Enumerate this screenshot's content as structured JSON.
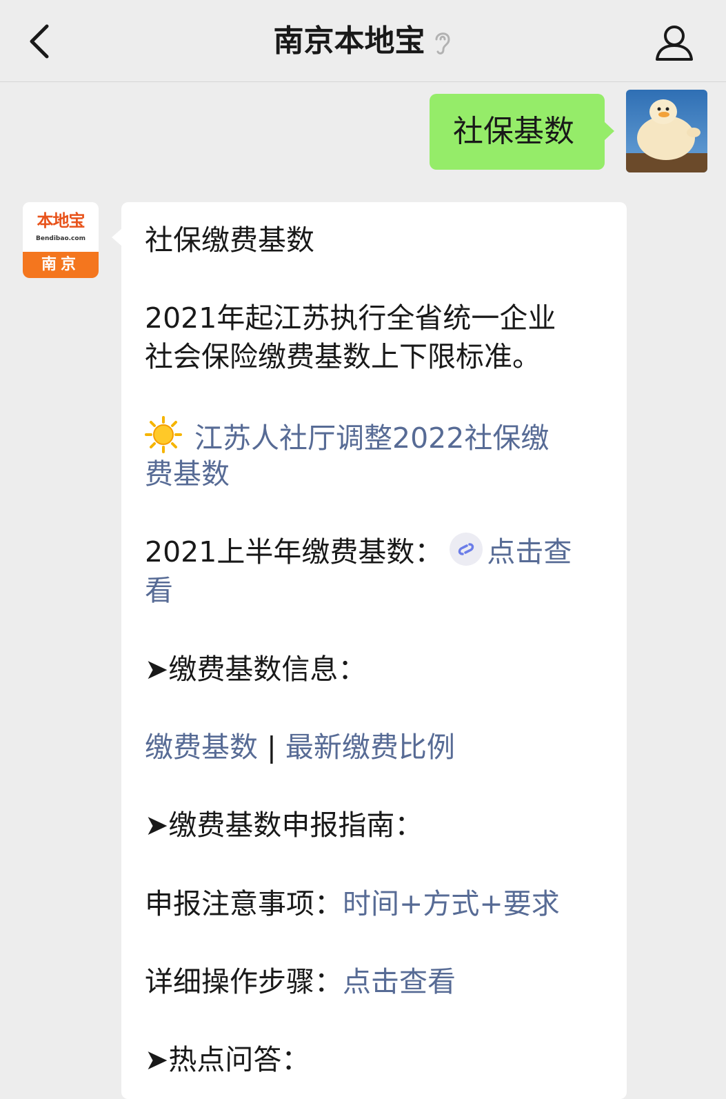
{
  "nav": {
    "title": "南京本地宝"
  },
  "user_message": {
    "text": "社保基数"
  },
  "bot": {
    "logo": {
      "name": "本地宝",
      "url": "Bendibao.com",
      "city": "南京"
    },
    "lines": {
      "title": "社保缴费基数",
      "intro_1": "2021年起江苏执行全省统一企业",
      "intro_2": "社会保险缴费基数上下限标准。",
      "adjust_link_1": "江苏人社厅调整2022社保缴",
      "adjust_link_2": "费基数",
      "h1_label": "2021上半年缴费基数：",
      "h1_link_1": "点击查",
      "h1_link_2": "看",
      "section_info": "➤缴费基数信息：",
      "info_link_a": "缴费基数",
      "info_sep": " | ",
      "info_link_b": "最新缴费比例",
      "section_guide": "➤缴费基数申报指南：",
      "notes_label": "申报注意事项：",
      "notes_link": "时间+方式+要求",
      "steps_label": "详细操作步骤：",
      "steps_link": "点击查看",
      "section_hot": "➤热点问答："
    }
  },
  "colors": {
    "background": "#ededed",
    "user_bubble": "#95ec69",
    "bot_bubble": "#ffffff",
    "link": "#576b95",
    "logo_orange": "#f4761e"
  },
  "icons": [
    "back-arrow-icon",
    "ear-icon",
    "profile-icon",
    "sun-icon",
    "mini-program-link-icon"
  ]
}
